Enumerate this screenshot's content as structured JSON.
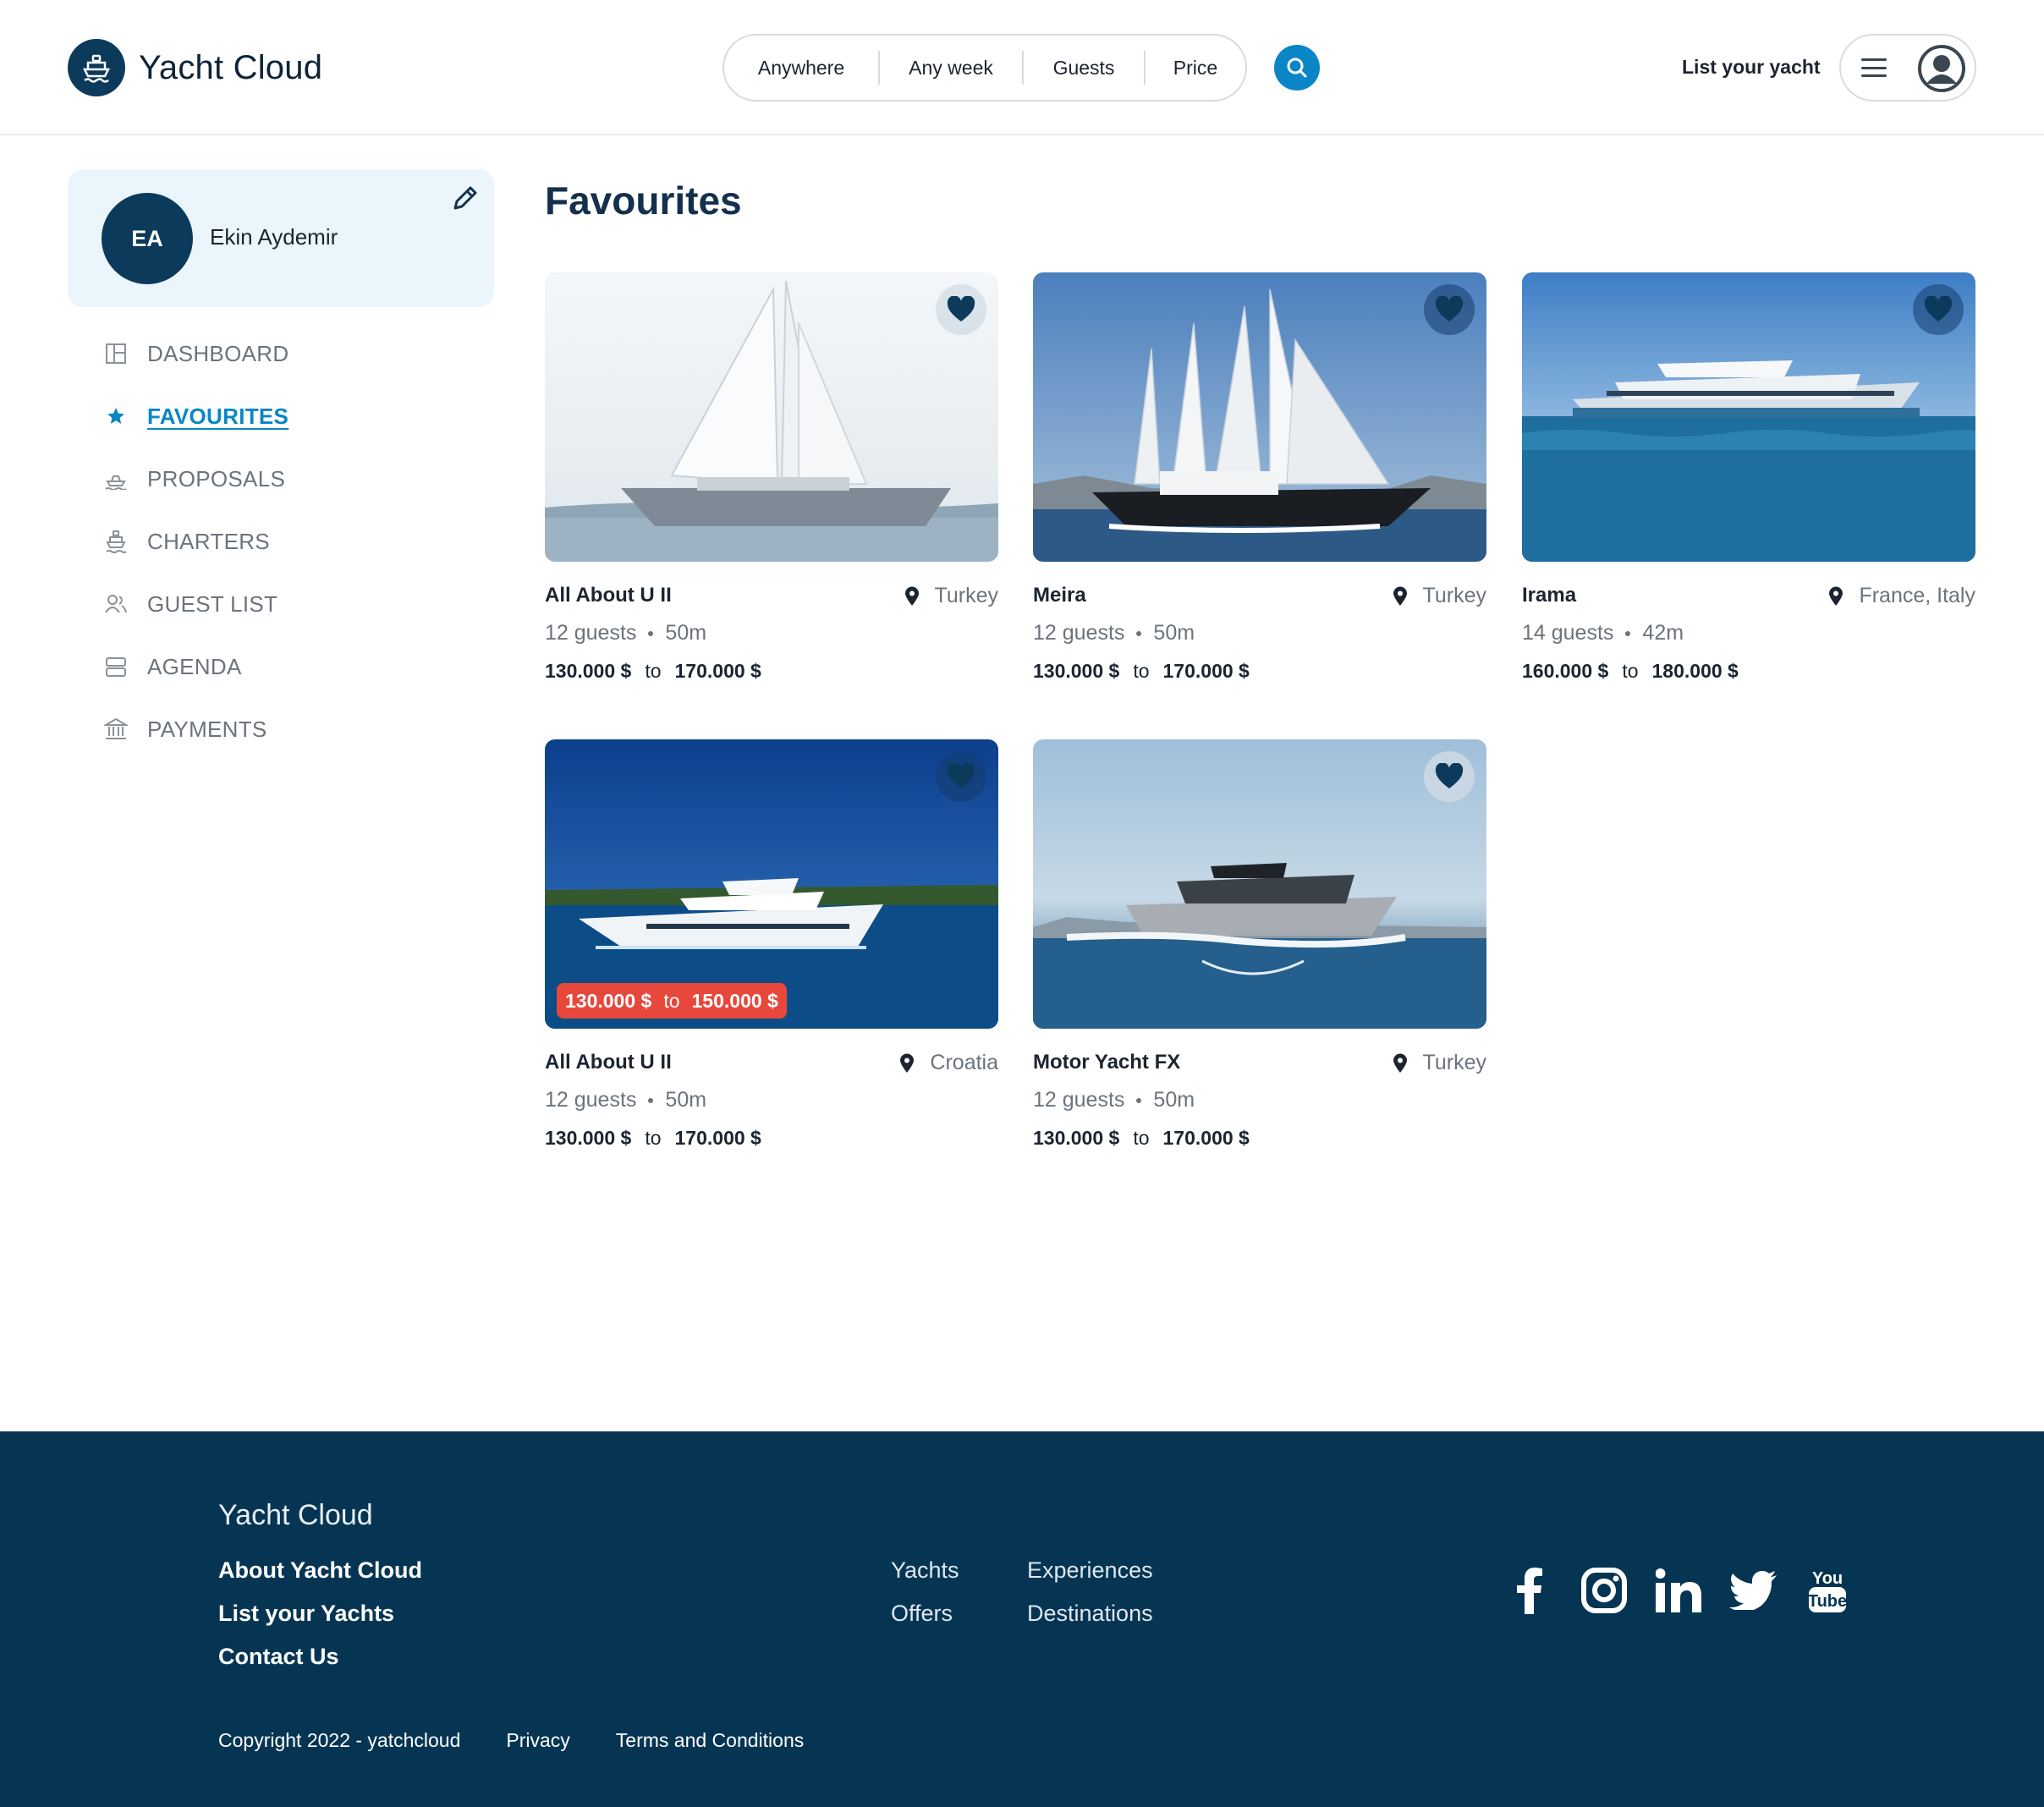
{
  "header": {
    "brand": "Yacht Cloud",
    "search": {
      "where": "Anywhere",
      "when": "Any week",
      "guests": "Guests",
      "price": "Price"
    },
    "list_yacht": "List your yacht"
  },
  "profile": {
    "initials": "EA",
    "name": "Ekin Aydemir"
  },
  "nav": [
    {
      "label": "DASHBOARD",
      "icon": "dashboard-icon",
      "active": false
    },
    {
      "label": "FAVOURITES",
      "icon": "star-icon",
      "active": true
    },
    {
      "label": "PROPOSALS",
      "icon": "proposals-icon",
      "active": false
    },
    {
      "label": "CHARTERS",
      "icon": "ship-icon",
      "active": false
    },
    {
      "label": "GUEST LIST",
      "icon": "guests-icon",
      "active": false
    },
    {
      "label": "AGENDA",
      "icon": "agenda-icon",
      "active": false
    },
    {
      "label": "PAYMENTS",
      "icon": "bank-icon",
      "active": false
    }
  ],
  "main": {
    "title": "Favourites",
    "cards": [
      {
        "name": "All About U II",
        "location": "Turkey",
        "guests": "12 guests",
        "length": "50m",
        "price_from": "130.000 $",
        "price_to": "170.000 $",
        "to": "to",
        "favourite": true
      },
      {
        "name": "Meira",
        "location": "Turkey",
        "guests": "12 guests",
        "length": "50m",
        "price_from": "130.000 $",
        "price_to": "170.000 $",
        "to": "to",
        "favourite": true
      },
      {
        "name": "Irama",
        "location": "France, Italy",
        "guests": "14 guests",
        "length": "42m",
        "price_from": "160.000 $",
        "price_to": "180.000 $",
        "to": "to",
        "favourite": true
      },
      {
        "name": "All About U II",
        "location": "Croatia",
        "guests": "12 guests",
        "length": "50m",
        "price_from": "130.000 $",
        "price_to": "170.000 $",
        "to": "to",
        "favourite": true,
        "badge": {
          "from": "130.000 $",
          "to_word": "to",
          "to": "150.000 $"
        }
      },
      {
        "name": "Motor Yacht FX",
        "location": "Turkey",
        "guests": "12 guests",
        "length": "50m",
        "price_from": "130.000 $",
        "price_to": "170.000 $",
        "to": "to",
        "favourite": true
      }
    ]
  },
  "footer": {
    "brand": "Yacht Cloud",
    "links_primary": [
      "About Yacht Cloud",
      "List your Yachts",
      "Contact Us"
    ],
    "links_col1": [
      "Yachts",
      "Offers"
    ],
    "links_col2": [
      "Experiences",
      "Destinations"
    ],
    "social": [
      "facebook-icon",
      "instagram-icon",
      "linkedin-icon",
      "twitter-icon",
      "youtube-icon"
    ],
    "copyright": "Copyright 2022 - yatchcloud",
    "privacy": "Privacy",
    "terms": "Terms and Conditions"
  },
  "colors": {
    "primary": "#0b3a5b",
    "accent": "#0a86c6",
    "price_badge": "#e8473b",
    "footer_bg": "#063553"
  }
}
